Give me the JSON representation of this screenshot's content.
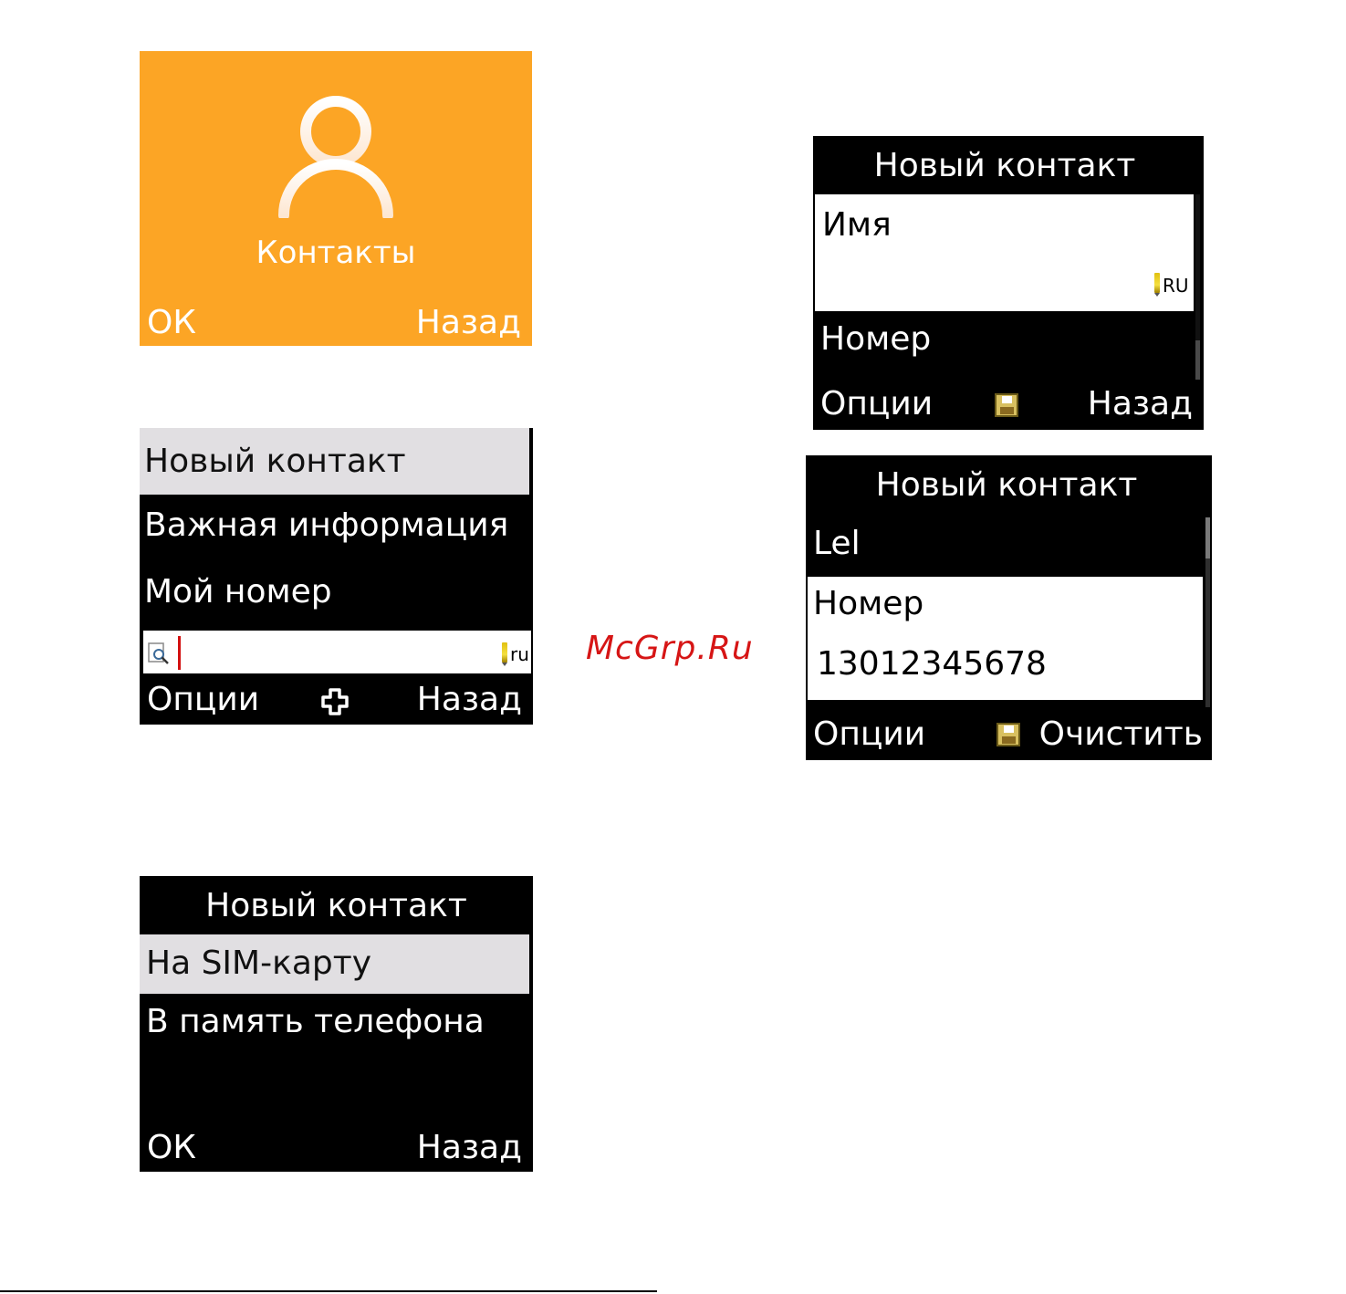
{
  "screen1": {
    "title": "Контакты",
    "softkey_left": "ОК",
    "softkey_right": "Назад",
    "background_color": "#fca525",
    "icon": "person-icon"
  },
  "screen2": {
    "items": [
      "Новый контакт",
      "Важная информация",
      "Мой номер"
    ],
    "search_lang": "ru",
    "softkey_left": "Опции",
    "softkey_right": "Назад",
    "center_icon": "dpad-icon"
  },
  "screen3": {
    "header": "Новый контакт",
    "items": [
      "На SIM-карту",
      "В память телефона"
    ],
    "softkey_left": "ОК",
    "softkey_right": "Назад"
  },
  "screen4": {
    "header": "Новый контакт",
    "field_name_label": "Имя",
    "input_lang": "RU",
    "field_number_label": "Номер",
    "softkey_left": "Опции",
    "softkey_right": "Назад",
    "center_icon": "save-icon"
  },
  "screen5": {
    "header": "Новый контакт",
    "name_value": "Lel",
    "field_number_label": "Номер",
    "number_value": "13012345678",
    "softkey_left": "Опции",
    "softkey_right": "Очистить",
    "center_icon": "save-icon"
  },
  "watermark": "McGrp.Ru"
}
